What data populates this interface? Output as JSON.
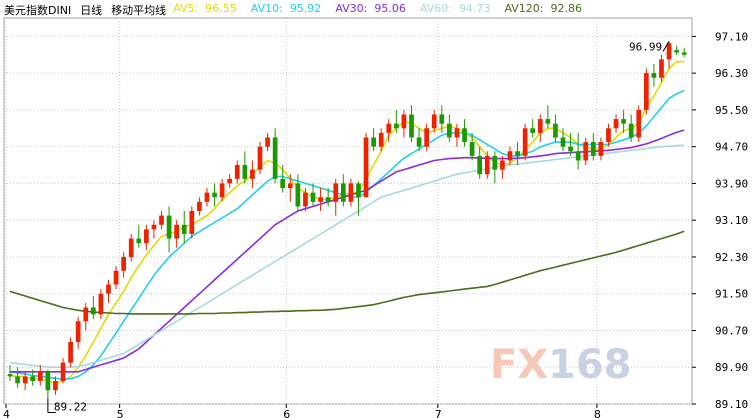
{
  "header": {
    "symbol": "美元指数DINI",
    "period": "日线",
    "ma_title": "移动平均线"
  },
  "legend": [
    {
      "label": "AV5:",
      "value": "96.55",
      "color": "#e0dc00"
    },
    {
      "label": "AV10:",
      "value": "95.92",
      "color": "#20d0f0"
    },
    {
      "label": "AV30:",
      "value": "95.06",
      "color": "#8a2be2"
    },
    {
      "label": "AV60:",
      "value": "94.73",
      "color": "#a8d8e0"
    },
    {
      "label": "AV120:",
      "value": "92.86",
      "color": "#4a6e1c"
    }
  ],
  "watermark": {
    "fx": "FX",
    "num": "168"
  },
  "colors": {
    "up": "#ee2200",
    "down": "#1a9900",
    "grid": "#c8c8c8",
    "frame": "#a0a0a0"
  },
  "chart_data": {
    "type": "candlestick",
    "ylim": [
      89.1,
      97.5
    ],
    "y_ticks": [
      "97.10",
      "96.30",
      "95.50",
      "94.70",
      "93.90",
      "93.10",
      "92.30",
      "91.50",
      "90.70",
      "89.90",
      "89.10"
    ],
    "x_ticks": [
      {
        "label": "4",
        "index": 0
      },
      {
        "label": "5",
        "index": 15
      },
      {
        "label": "6",
        "index": 37
      },
      {
        "label": "7",
        "index": 57
      },
      {
        "label": "8",
        "index": 78
      }
    ],
    "annotations": [
      {
        "text": "89.22",
        "index": 5,
        "value": 89.22,
        "kind": "low"
      },
      {
        "text": "96.99",
        "index": 87,
        "value": 96.99,
        "kind": "high"
      }
    ],
    "candles": [
      [
        89.75,
        89.95,
        89.6,
        89.7
      ],
      [
        89.7,
        89.9,
        89.45,
        89.55
      ],
      [
        89.55,
        89.8,
        89.4,
        89.7
      ],
      [
        89.7,
        89.85,
        89.5,
        89.6
      ],
      [
        89.6,
        89.95,
        89.5,
        89.8
      ],
      [
        89.8,
        89.85,
        89.22,
        89.4
      ],
      [
        89.4,
        89.7,
        89.3,
        89.6
      ],
      [
        89.6,
        90.1,
        89.55,
        90.0
      ],
      [
        90.0,
        90.55,
        89.9,
        90.45
      ],
      [
        90.45,
        91.0,
        90.3,
        90.9
      ],
      [
        90.9,
        91.3,
        90.7,
        91.2
      ],
      [
        91.2,
        91.45,
        90.95,
        91.05
      ],
      [
        91.05,
        91.6,
        90.95,
        91.5
      ],
      [
        91.5,
        91.8,
        91.3,
        91.7
      ],
      [
        91.7,
        92.1,
        91.6,
        92.0
      ],
      [
        92.0,
        92.4,
        91.85,
        92.3
      ],
      [
        92.3,
        92.8,
        92.2,
        92.7
      ],
      [
        92.7,
        93.0,
        92.5,
        92.6
      ],
      [
        92.6,
        93.0,
        92.45,
        92.9
      ],
      [
        92.9,
        93.1,
        92.7,
        93.0
      ],
      [
        93.0,
        93.3,
        92.9,
        93.2
      ],
      [
        93.2,
        93.4,
        92.4,
        92.7
      ],
      [
        92.7,
        93.1,
        92.5,
        93.0
      ],
      [
        93.0,
        93.3,
        92.6,
        92.8
      ],
      [
        92.8,
        93.4,
        92.7,
        93.3
      ],
      [
        93.3,
        93.6,
        93.2,
        93.5
      ],
      [
        93.5,
        93.8,
        93.4,
        93.7
      ],
      [
        93.7,
        93.9,
        93.4,
        93.6
      ],
      [
        93.6,
        94.0,
        93.5,
        93.9
      ],
      [
        93.9,
        94.1,
        93.8,
        94.0
      ],
      [
        94.0,
        94.4,
        93.9,
        94.3
      ],
      [
        94.3,
        94.6,
        93.9,
        94.0
      ],
      [
        94.0,
        94.4,
        93.8,
        94.2
      ],
      [
        94.2,
        94.8,
        94.1,
        94.7
      ],
      [
        94.7,
        95.0,
        94.6,
        94.9
      ],
      [
        94.9,
        95.1,
        93.9,
        94.0
      ],
      [
        94.0,
        94.3,
        93.7,
        93.8
      ],
      [
        93.8,
        94.1,
        93.5,
        93.9
      ],
      [
        93.9,
        94.1,
        93.3,
        93.4
      ],
      [
        93.4,
        93.8,
        93.3,
        93.7
      ],
      [
        93.7,
        93.9,
        93.4,
        93.5
      ],
      [
        93.5,
        93.8,
        93.3,
        93.6
      ],
      [
        93.6,
        93.8,
        93.4,
        93.5
      ],
      [
        93.5,
        94.0,
        93.2,
        93.9
      ],
      [
        93.9,
        94.1,
        93.4,
        93.5
      ],
      [
        93.5,
        94.0,
        93.4,
        93.9
      ],
      [
        93.9,
        93.95,
        93.2,
        93.6
      ],
      [
        93.6,
        95.0,
        93.6,
        94.9
      ],
      [
        94.9,
        95.1,
        94.6,
        94.7
      ],
      [
        94.7,
        95.1,
        94.6,
        95.0
      ],
      [
        95.0,
        95.3,
        94.8,
        95.2
      ],
      [
        95.2,
        95.5,
        95.0,
        95.1
      ],
      [
        95.1,
        95.5,
        94.9,
        95.4
      ],
      [
        95.4,
        95.6,
        94.8,
        94.9
      ],
      [
        94.9,
        95.1,
        94.6,
        94.7
      ],
      [
        94.7,
        95.2,
        94.6,
        95.1
      ],
      [
        95.1,
        95.5,
        95.0,
        95.4
      ],
      [
        95.4,
        95.6,
        95.0,
        95.2
      ],
      [
        95.2,
        95.4,
        94.8,
        94.9
      ],
      [
        94.9,
        95.2,
        94.7,
        95.1
      ],
      [
        95.1,
        95.3,
        94.7,
        94.8
      ],
      [
        94.8,
        95.0,
        94.4,
        94.5
      ],
      [
        94.5,
        94.7,
        94.0,
        94.1
      ],
      [
        94.1,
        94.6,
        94.0,
        94.5
      ],
      [
        94.5,
        94.6,
        93.9,
        94.2
      ],
      [
        94.2,
        94.5,
        94.0,
        94.4
      ],
      [
        94.4,
        94.7,
        94.3,
        94.6
      ],
      [
        94.6,
        94.8,
        94.3,
        94.5
      ],
      [
        94.5,
        95.2,
        94.4,
        95.1
      ],
      [
        95.1,
        95.3,
        94.9,
        95.0
      ],
      [
        95.0,
        95.4,
        94.8,
        95.3
      ],
      [
        95.3,
        95.6,
        95.1,
        95.2
      ],
      [
        95.2,
        95.4,
        94.8,
        94.9
      ],
      [
        94.9,
        95.1,
        94.6,
        94.7
      ],
      [
        94.7,
        95.0,
        94.5,
        94.6
      ],
      [
        94.6,
        95.0,
        94.2,
        94.4
      ],
      [
        94.4,
        94.9,
        94.3,
        94.8
      ],
      [
        94.8,
        95.0,
        94.4,
        94.5
      ],
      [
        94.5,
        94.9,
        94.4,
        94.8
      ],
      [
        94.8,
        95.2,
        94.7,
        95.1
      ],
      [
        95.1,
        95.4,
        95.0,
        95.3
      ],
      [
        95.3,
        95.5,
        95.0,
        95.2
      ],
      [
        95.2,
        95.4,
        94.8,
        94.9
      ],
      [
        94.9,
        95.6,
        94.8,
        95.5
      ],
      [
        95.5,
        96.4,
        95.4,
        96.3
      ],
      [
        96.3,
        96.5,
        96.0,
        96.2
      ],
      [
        96.2,
        96.7,
        96.1,
        96.6
      ],
      [
        96.6,
        96.99,
        96.4,
        96.95
      ],
      [
        96.8,
        96.9,
        96.7,
        96.75
      ],
      [
        96.75,
        96.85,
        96.65,
        96.7
      ]
    ],
    "series": [
      {
        "name": "AV5",
        "color": "#e0dc00",
        "values": [
          89.72,
          89.7,
          89.68,
          89.66,
          89.65,
          89.6,
          89.55,
          89.6,
          89.7,
          89.9,
          90.15,
          90.45,
          90.75,
          91.05,
          91.3,
          91.55,
          91.85,
          92.1,
          92.35,
          92.55,
          92.75,
          92.8,
          92.85,
          92.95,
          93.0,
          93.1,
          93.2,
          93.35,
          93.55,
          93.7,
          93.85,
          93.95,
          94.1,
          94.25,
          94.4,
          94.35,
          94.2,
          94.0,
          93.8,
          93.7,
          93.6,
          93.55,
          93.55,
          93.6,
          93.65,
          93.7,
          93.7,
          94.0,
          94.3,
          94.6,
          94.95,
          95.1,
          95.25,
          95.2,
          95.1,
          95.0,
          95.05,
          95.1,
          95.15,
          95.1,
          95.0,
          94.9,
          94.7,
          94.5,
          94.35,
          94.3,
          94.35,
          94.45,
          94.65,
          94.8,
          95.0,
          95.1,
          95.1,
          95.0,
          94.9,
          94.75,
          94.7,
          94.65,
          94.65,
          94.75,
          94.9,
          95.05,
          95.1,
          95.2,
          95.55,
          95.8,
          96.1,
          96.4,
          96.55,
          96.55
        ]
      },
      {
        "name": "AV10",
        "color": "#20d0f0",
        "values": [
          89.8,
          89.78,
          89.75,
          89.72,
          89.7,
          89.68,
          89.66,
          89.64,
          89.65,
          89.7,
          89.8,
          89.95,
          90.15,
          90.4,
          90.65,
          90.9,
          91.15,
          91.4,
          91.65,
          91.9,
          92.1,
          92.3,
          92.45,
          92.6,
          92.75,
          92.85,
          92.95,
          93.05,
          93.15,
          93.25,
          93.35,
          93.5,
          93.65,
          93.8,
          93.95,
          94.05,
          94.05,
          94.0,
          93.95,
          93.9,
          93.85,
          93.8,
          93.75,
          93.7,
          93.65,
          93.6,
          93.6,
          93.7,
          93.85,
          94.0,
          94.15,
          94.3,
          94.45,
          94.55,
          94.65,
          94.75,
          94.85,
          94.95,
          95.0,
          95.0,
          95.0,
          94.95,
          94.85,
          94.75,
          94.65,
          94.55,
          94.5,
          94.5,
          94.55,
          94.6,
          94.7,
          94.75,
          94.8,
          94.8,
          94.8,
          94.75,
          94.75,
          94.75,
          94.75,
          94.75,
          94.8,
          94.85,
          94.9,
          95.0,
          95.15,
          95.35,
          95.55,
          95.75,
          95.85,
          95.92
        ]
      },
      {
        "name": "AV30",
        "color": "#8a2be2",
        "values": [
          89.8,
          89.8,
          89.8,
          89.8,
          89.8,
          89.8,
          89.8,
          89.8,
          89.8,
          89.8,
          89.85,
          89.9,
          89.95,
          90.0,
          90.05,
          90.1,
          90.2,
          90.3,
          90.45,
          90.6,
          90.75,
          90.9,
          91.05,
          91.2,
          91.35,
          91.5,
          91.65,
          91.8,
          91.95,
          92.1,
          92.25,
          92.4,
          92.55,
          92.7,
          92.85,
          93.0,
          93.1,
          93.2,
          93.3,
          93.35,
          93.4,
          93.45,
          93.5,
          93.55,
          93.6,
          93.65,
          93.7,
          93.75,
          93.85,
          93.95,
          94.05,
          94.15,
          94.2,
          94.25,
          94.3,
          94.35,
          94.4,
          94.42,
          94.44,
          94.45,
          94.46,
          94.46,
          94.45,
          94.45,
          94.44,
          94.44,
          94.44,
          94.45,
          94.46,
          94.48,
          94.5,
          94.52,
          94.55,
          94.56,
          94.57,
          94.58,
          94.59,
          94.6,
          94.61,
          94.62,
          94.64,
          94.66,
          94.68,
          94.72,
          94.76,
          94.82,
          94.88,
          94.95,
          95.01,
          95.06
        ]
      },
      {
        "name": "AV60",
        "color": "#a8d8e0",
        "values": [
          90.0,
          89.98,
          89.96,
          89.94,
          89.92,
          89.9,
          89.9,
          89.9,
          89.9,
          89.92,
          89.95,
          90.0,
          90.05,
          90.1,
          90.15,
          90.2,
          90.3,
          90.4,
          90.5,
          90.6,
          90.7,
          90.8,
          90.9,
          91.0,
          91.1,
          91.2,
          91.3,
          91.4,
          91.5,
          91.6,
          91.7,
          91.8,
          91.9,
          92.0,
          92.1,
          92.2,
          92.3,
          92.4,
          92.5,
          92.6,
          92.7,
          92.8,
          92.9,
          93.0,
          93.1,
          93.2,
          93.3,
          93.4,
          93.5,
          93.6,
          93.65,
          93.7,
          93.75,
          93.8,
          93.85,
          93.9,
          93.95,
          94.0,
          94.05,
          94.1,
          94.13,
          94.16,
          94.19,
          94.22,
          94.25,
          94.28,
          94.3,
          94.32,
          94.34,
          94.36,
          94.38,
          94.4,
          94.42,
          94.44,
          94.46,
          94.48,
          94.5,
          94.52,
          94.54,
          94.56,
          94.58,
          94.6,
          94.62,
          94.64,
          94.66,
          94.68,
          94.7,
          94.71,
          94.72,
          94.73
        ]
      },
      {
        "name": "AV120",
        "color": "#4a6e1c",
        "values": [
          91.55,
          91.5,
          91.45,
          91.4,
          91.35,
          91.3,
          91.25,
          91.2,
          91.17,
          91.14,
          91.12,
          91.1,
          91.09,
          91.08,
          91.07,
          91.07,
          91.06,
          91.06,
          91.06,
          91.06,
          91.06,
          91.06,
          91.06,
          91.06,
          91.06,
          91.07,
          91.07,
          91.07,
          91.08,
          91.08,
          91.09,
          91.09,
          91.1,
          91.1,
          91.11,
          91.11,
          91.12,
          91.12,
          91.13,
          91.13,
          91.14,
          91.14,
          91.15,
          91.16,
          91.18,
          91.2,
          91.22,
          91.24,
          91.26,
          91.3,
          91.34,
          91.38,
          91.42,
          91.45,
          91.48,
          91.5,
          91.52,
          91.54,
          91.56,
          91.58,
          91.6,
          91.62,
          91.64,
          91.66,
          91.7,
          91.75,
          91.8,
          91.85,
          91.9,
          91.95,
          92.0,
          92.04,
          92.08,
          92.12,
          92.16,
          92.2,
          92.24,
          92.28,
          92.32,
          92.36,
          92.4,
          92.45,
          92.5,
          92.55,
          92.6,
          92.65,
          92.7,
          92.75,
          92.8,
          92.86
        ]
      }
    ]
  }
}
